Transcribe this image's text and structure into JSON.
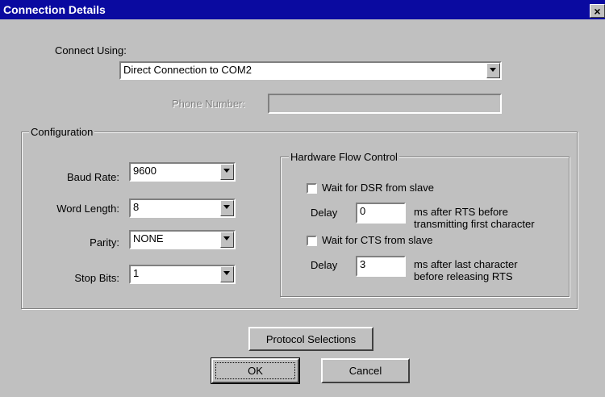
{
  "window": {
    "title": "Connection Details",
    "close_glyph": "×"
  },
  "connect": {
    "label": "Connect Using:",
    "value": "Direct Connection to COM2"
  },
  "phone": {
    "label": "Phone Number:",
    "value": ""
  },
  "configuration": {
    "title": "Configuration",
    "baud": {
      "label": "Baud Rate:",
      "value": "9600"
    },
    "word": {
      "label": "Word Length:",
      "value": "8"
    },
    "parity": {
      "label": "Parity:",
      "value": "NONE"
    },
    "stop": {
      "label": "Stop Bits:",
      "value": "1"
    }
  },
  "flow": {
    "title": "Hardware Flow Control",
    "dsr": {
      "label": "Wait for DSR from slave",
      "checked": false,
      "delay_label": "Delay",
      "delay_value": "0",
      "desc_line1": "ms after RTS before",
      "desc_line2": "transmitting first character"
    },
    "cts": {
      "label": "Wait for CTS from slave",
      "checked": false,
      "delay_label": "Delay",
      "delay_value": "3",
      "desc_line1": "ms after last character",
      "desc_line2": "before releasing RTS"
    }
  },
  "buttons": {
    "protocol": "Protocol Selections",
    "ok": "OK",
    "cancel": "Cancel"
  }
}
